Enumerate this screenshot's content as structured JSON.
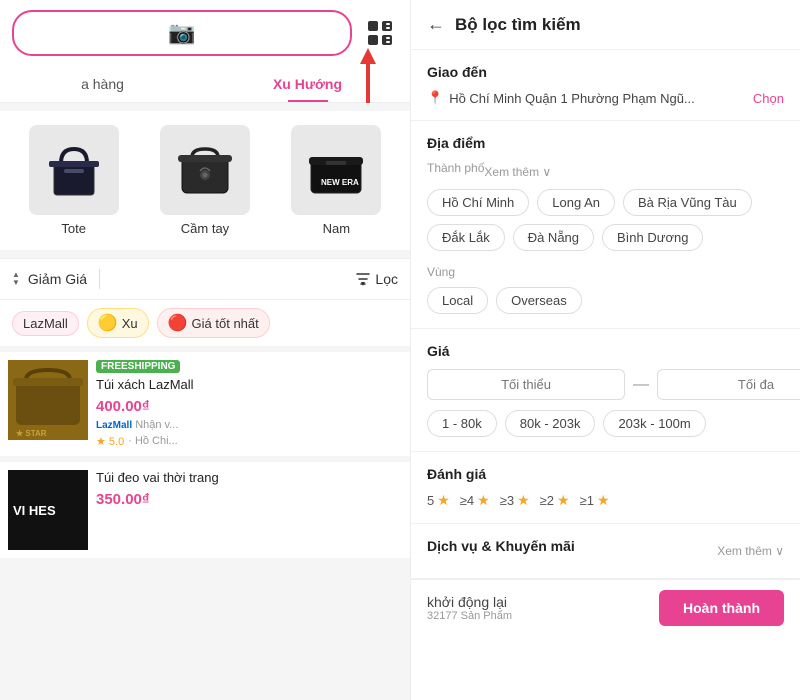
{
  "left": {
    "search": {
      "placeholder": ""
    },
    "nav_tabs": [
      {
        "label": "a hàng",
        "active": false
      },
      {
        "label": "Xu Hướng",
        "active": true
      }
    ],
    "categories": [
      {
        "id": "tote",
        "label": "Tote"
      },
      {
        "id": "camtay",
        "label": "Cầm tay"
      },
      {
        "id": "nam",
        "label": "Nam"
      }
    ],
    "filter_bar": {
      "discount_label": "Giảm Giá",
      "filter_label": "Lọc"
    },
    "tags": [
      {
        "label": "LazMall",
        "type": "lazmall"
      },
      {
        "label": "Xu",
        "type": "xu"
      },
      {
        "label": "Giá tốt nhất",
        "type": "price"
      }
    ],
    "product_preview": {
      "text": "VI HES",
      "price": "400.00",
      "freeship": "FREESHIPPING"
    }
  },
  "right": {
    "title": "Bộ lọc tìm kiếm",
    "sections": {
      "delivery": {
        "title": "Giao đến",
        "location": "Hồ Chí Minh Quận 1 Phường Phạm Ngũ...",
        "action": "Chọn"
      },
      "region": {
        "title": "Địa điểm",
        "sub_label_city": "Thành phố",
        "see_more": "Xem thêm ∨",
        "cities": [
          {
            "label": "Hồ Chí Minh",
            "active": false
          },
          {
            "label": "Long An",
            "active": false
          },
          {
            "label": "Bà Rịa Vũng Tàu",
            "active": false
          },
          {
            "label": "Đắk Lắk",
            "active": false
          },
          {
            "label": "Đà Nẵng",
            "active": false
          },
          {
            "label": "Bình Dương",
            "active": false
          }
        ],
        "sub_label_vung": "Vùng",
        "zones": [
          {
            "label": "Local",
            "active": false
          },
          {
            "label": "Overseas",
            "active": false
          }
        ]
      },
      "price": {
        "title": "Giá",
        "min_placeholder": "Tối thiểu",
        "max_placeholder": "Tối đa",
        "ranges": [
          {
            "label": "1 - 80k"
          },
          {
            "label": "80k - 203k"
          },
          {
            "label": "203k - 100m"
          }
        ]
      },
      "rating": {
        "title": "Đánh giá",
        "items": [
          {
            "stars": 5,
            "min": 5
          },
          {
            "stars": 4,
            "min": 4,
            "prefix": "≥"
          },
          {
            "stars": 3,
            "min": 3,
            "prefix": "≥"
          },
          {
            "stars": 2,
            "min": 2,
            "prefix": "≥"
          },
          {
            "stars": 1,
            "min": 1,
            "prefix": "≥"
          }
        ]
      },
      "services": {
        "title": "Dịch vụ & Khuyến mãi",
        "see_more": "Xem thêm ∨"
      }
    },
    "bottom": {
      "reset_label": "khởi động lại",
      "done_label": "Hoàn thành",
      "count": "32177 Sản Phẩm"
    }
  }
}
